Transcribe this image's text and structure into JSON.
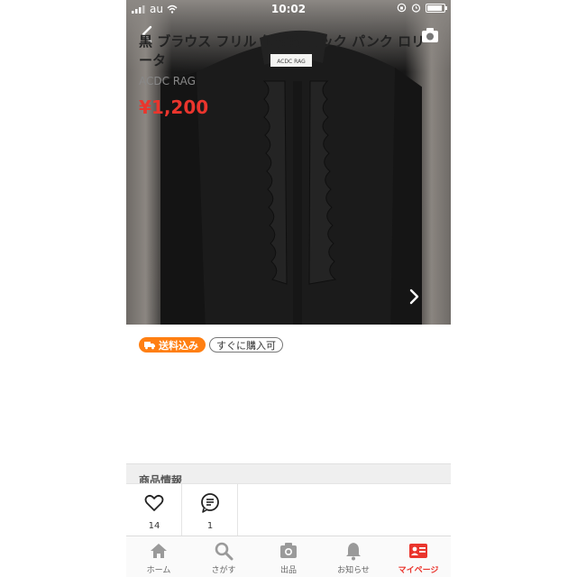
{
  "status_bar": {
    "carrier": "au",
    "time": "10:02"
  },
  "badges": {
    "shipping": "送料込み",
    "instant_buy": "すぐに購入可"
  },
  "product": {
    "title": "黒 ブラウス フリル 個性的 ロック パンク ロリータ",
    "brand": "ACDC RAG",
    "price": "¥1,200",
    "tag_label": "ACDC RAG"
  },
  "section": {
    "header": "商品情報"
  },
  "actions": {
    "likes": "14",
    "comments": "1"
  },
  "tabbar": {
    "items": [
      {
        "label": "ホーム",
        "icon": "home-icon"
      },
      {
        "label": "さがす",
        "icon": "search-icon"
      },
      {
        "label": "出品",
        "icon": "camera-icon"
      },
      {
        "label": "お知らせ",
        "icon": "bell-icon"
      },
      {
        "label": "マイページ",
        "icon": "profile-card-icon"
      }
    ],
    "active": "マイページ"
  },
  "colors": {
    "accent": "#ea352d",
    "shipping_badge": "#ff7f12"
  }
}
